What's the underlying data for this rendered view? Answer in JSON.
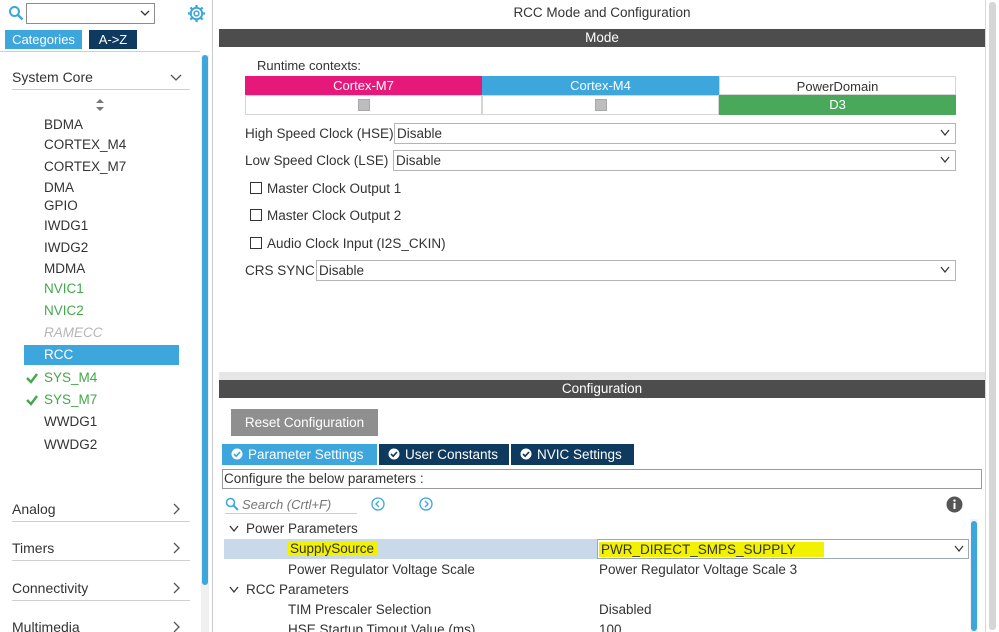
{
  "left": {
    "search": {
      "value": ""
    },
    "tabs": [
      {
        "label": "Categories"
      },
      {
        "label": "A->Z"
      }
    ],
    "categories": {
      "system_core": "System Core",
      "analog": "Analog",
      "timers": "Timers",
      "connectivity": "Connectivity",
      "multimedia": "Multimedia"
    },
    "peripherals": [
      {
        "label": "BDMA",
        "state": "normal"
      },
      {
        "label": "CORTEX_M4",
        "state": "normal"
      },
      {
        "label": "CORTEX_M7",
        "state": "normal"
      },
      {
        "label": "DMA",
        "state": "normal"
      },
      {
        "label": "GPIO",
        "state": "normal"
      },
      {
        "label": "IWDG1",
        "state": "normal"
      },
      {
        "label": "IWDG2",
        "state": "normal"
      },
      {
        "label": "MDMA",
        "state": "normal"
      },
      {
        "label": "NVIC1",
        "state": "green"
      },
      {
        "label": "NVIC2",
        "state": "green"
      },
      {
        "label": "RAMECC",
        "state": "disabled"
      },
      {
        "label": "RCC",
        "state": "selected"
      },
      {
        "label": "SYS_M4",
        "state": "checked"
      },
      {
        "label": "SYS_M7",
        "state": "checked"
      },
      {
        "label": "WWDG1",
        "state": "normal"
      },
      {
        "label": "WWDG2",
        "state": "normal"
      }
    ],
    "colors": {
      "accent": "#3da6dc",
      "green": "#43a84a",
      "az_tab": "#0e3a60"
    }
  },
  "main": {
    "title": "RCC Mode and Configuration",
    "mode_bar": "Mode",
    "config_bar": "Configuration",
    "runtime_label": "Runtime contexts:",
    "contexts": [
      {
        "label": "Cortex-M7",
        "color": "#e6197a",
        "checked": true
      },
      {
        "label": "Cortex-M4",
        "color": "#3da6dc",
        "checked": true
      },
      {
        "label": "PowerDomain",
        "color": "#ffffff",
        "value": "D3",
        "value_color": "#4aa85b"
      }
    ],
    "hse": {
      "label": "High Speed Clock (HSE)",
      "value": "Disable"
    },
    "lse": {
      "label": "Low Speed Clock (LSE)",
      "value": "Disable"
    },
    "checkboxes": [
      {
        "label": "Master Clock Output 1",
        "checked": false
      },
      {
        "label": "Master Clock Output 2",
        "checked": false
      },
      {
        "label": "Audio Clock Input (I2S_CKIN)",
        "checked": false
      }
    ],
    "crs": {
      "label": "CRS SYNC",
      "value": "Disable"
    },
    "reset_label": "Reset Configuration",
    "config_tabs": [
      {
        "label": "Parameter Settings",
        "color": "#3da6dc"
      },
      {
        "label": "User Constants",
        "color": "#0e3a60"
      },
      {
        "label": "NVIC Settings",
        "color": "#0e3a60"
      }
    ],
    "param_header": "Configure the below parameters :",
    "search_placeholder": "Search (Crtl+F)",
    "groups": {
      "power": "Power Parameters",
      "rcc": "RCC Parameters"
    },
    "params": [
      {
        "name": "SupplySource",
        "value": "PWR_DIRECT_SMPS_SUPPLY",
        "highlighted": true
      },
      {
        "name": "Power Regulator Voltage Scale",
        "value": "Power Regulator Voltage Scale 3"
      },
      {
        "name": "TIM Prescaler Selection",
        "value": "Disabled"
      },
      {
        "name": "HSE Startup Timout Value (ms)",
        "value": "100"
      }
    ],
    "colors": {
      "highlight": "#f2f200",
      "selected_row": "#c9d9ea",
      "bar": "#4d4d4d"
    }
  }
}
